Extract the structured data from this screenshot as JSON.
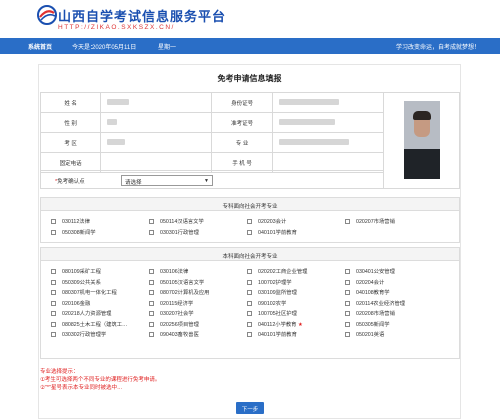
{
  "header": {
    "site_title": "山西自学考试信息服务平台",
    "site_url": "HTTP://ZIKAO.SXKSZX.CN/"
  },
  "nav": {
    "home": "系统首页",
    "today_label": "今天是：",
    "date": "2020年05月11日",
    "weekday": "星期一",
    "slogan": "学习改变命运，自考成就梦想！"
  },
  "form": {
    "title": "免考申请信息填报",
    "labels": {
      "name": "姓  名",
      "id_no": "身份证号",
      "gender": "性  别",
      "exam_no": "准考证号",
      "exam_area": "考  区",
      "major": "专  业",
      "fixed_phone": "固定电话",
      "mobile": "手 机 号"
    },
    "exempt_point_label": "*免考确认点",
    "exempt_point_value": "请选择"
  },
  "specialty_section": {
    "title": "专科面向社会开考专业",
    "items": [
      "030112法律",
      "050114汉语言文学",
      "020203会计",
      "020207市场营销",
      "050308新闻学",
      "030301行政管理",
      "040101学前教育"
    ]
  },
  "undergrad_section": {
    "title": "本科面向社会开考专业",
    "items": [
      "080109采矿工程",
      "030106法律",
      "020202工商企业管理",
      "030401公安管理",
      "050309公共关系",
      "050105汉语言文学",
      "100702护理学",
      "020204会计",
      "080307机电一体化工程",
      "080702计算机及应用",
      "030109监所管理",
      "040108教育学",
      "020106金融",
      "020115经济学",
      "090102农学",
      "020114农业经济管理",
      "020218人力资源管理",
      "030207社会学",
      "100705社区护理",
      "020208市场营销",
      "080825土木工程（建筑工…",
      "020256项目管理",
      "040112小学教育",
      "050305新闻学",
      "030302行政管理学",
      "090403畜牧兽医",
      "040101学前教育",
      "050201英语"
    ]
  },
  "notes": {
    "title": "专业选择提示：",
    "line1": "①考生可选择两个不同专业的课程进行免考申请。",
    "line2": "②\"*\"星号表示本专业同时被选中…"
  },
  "next_button": "下一步",
  "colors": {
    "brand": "#2a6ec7",
    "warning": "#e02020"
  }
}
